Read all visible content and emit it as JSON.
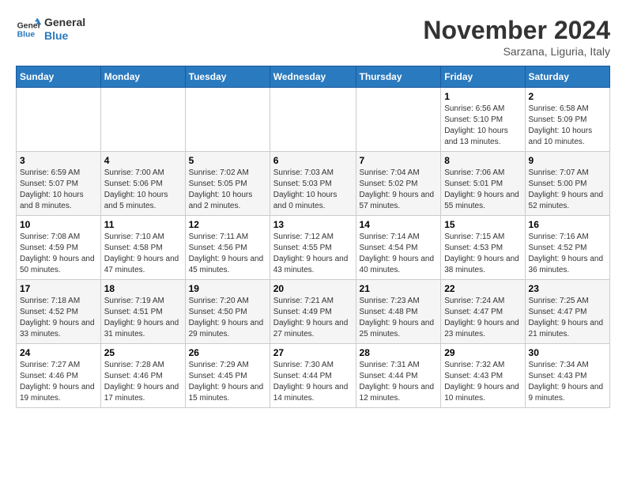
{
  "header": {
    "logo_line1": "General",
    "logo_line2": "Blue",
    "month_title": "November 2024",
    "subtitle": "Sarzana, Liguria, Italy"
  },
  "weekdays": [
    "Sunday",
    "Monday",
    "Tuesday",
    "Wednesday",
    "Thursday",
    "Friday",
    "Saturday"
  ],
  "weeks": [
    [
      {
        "day": "",
        "info": ""
      },
      {
        "day": "",
        "info": ""
      },
      {
        "day": "",
        "info": ""
      },
      {
        "day": "",
        "info": ""
      },
      {
        "day": "",
        "info": ""
      },
      {
        "day": "1",
        "info": "Sunrise: 6:56 AM\nSunset: 5:10 PM\nDaylight: 10 hours and 13 minutes."
      },
      {
        "day": "2",
        "info": "Sunrise: 6:58 AM\nSunset: 5:09 PM\nDaylight: 10 hours and 10 minutes."
      }
    ],
    [
      {
        "day": "3",
        "info": "Sunrise: 6:59 AM\nSunset: 5:07 PM\nDaylight: 10 hours and 8 minutes."
      },
      {
        "day": "4",
        "info": "Sunrise: 7:00 AM\nSunset: 5:06 PM\nDaylight: 10 hours and 5 minutes."
      },
      {
        "day": "5",
        "info": "Sunrise: 7:02 AM\nSunset: 5:05 PM\nDaylight: 10 hours and 2 minutes."
      },
      {
        "day": "6",
        "info": "Sunrise: 7:03 AM\nSunset: 5:03 PM\nDaylight: 10 hours and 0 minutes."
      },
      {
        "day": "7",
        "info": "Sunrise: 7:04 AM\nSunset: 5:02 PM\nDaylight: 9 hours and 57 minutes."
      },
      {
        "day": "8",
        "info": "Sunrise: 7:06 AM\nSunset: 5:01 PM\nDaylight: 9 hours and 55 minutes."
      },
      {
        "day": "9",
        "info": "Sunrise: 7:07 AM\nSunset: 5:00 PM\nDaylight: 9 hours and 52 minutes."
      }
    ],
    [
      {
        "day": "10",
        "info": "Sunrise: 7:08 AM\nSunset: 4:59 PM\nDaylight: 9 hours and 50 minutes."
      },
      {
        "day": "11",
        "info": "Sunrise: 7:10 AM\nSunset: 4:58 PM\nDaylight: 9 hours and 47 minutes."
      },
      {
        "day": "12",
        "info": "Sunrise: 7:11 AM\nSunset: 4:56 PM\nDaylight: 9 hours and 45 minutes."
      },
      {
        "day": "13",
        "info": "Sunrise: 7:12 AM\nSunset: 4:55 PM\nDaylight: 9 hours and 43 minutes."
      },
      {
        "day": "14",
        "info": "Sunrise: 7:14 AM\nSunset: 4:54 PM\nDaylight: 9 hours and 40 minutes."
      },
      {
        "day": "15",
        "info": "Sunrise: 7:15 AM\nSunset: 4:53 PM\nDaylight: 9 hours and 38 minutes."
      },
      {
        "day": "16",
        "info": "Sunrise: 7:16 AM\nSunset: 4:52 PM\nDaylight: 9 hours and 36 minutes."
      }
    ],
    [
      {
        "day": "17",
        "info": "Sunrise: 7:18 AM\nSunset: 4:52 PM\nDaylight: 9 hours and 33 minutes."
      },
      {
        "day": "18",
        "info": "Sunrise: 7:19 AM\nSunset: 4:51 PM\nDaylight: 9 hours and 31 minutes."
      },
      {
        "day": "19",
        "info": "Sunrise: 7:20 AM\nSunset: 4:50 PM\nDaylight: 9 hours and 29 minutes."
      },
      {
        "day": "20",
        "info": "Sunrise: 7:21 AM\nSunset: 4:49 PM\nDaylight: 9 hours and 27 minutes."
      },
      {
        "day": "21",
        "info": "Sunrise: 7:23 AM\nSunset: 4:48 PM\nDaylight: 9 hours and 25 minutes."
      },
      {
        "day": "22",
        "info": "Sunrise: 7:24 AM\nSunset: 4:47 PM\nDaylight: 9 hours and 23 minutes."
      },
      {
        "day": "23",
        "info": "Sunrise: 7:25 AM\nSunset: 4:47 PM\nDaylight: 9 hours and 21 minutes."
      }
    ],
    [
      {
        "day": "24",
        "info": "Sunrise: 7:27 AM\nSunset: 4:46 PM\nDaylight: 9 hours and 19 minutes."
      },
      {
        "day": "25",
        "info": "Sunrise: 7:28 AM\nSunset: 4:46 PM\nDaylight: 9 hours and 17 minutes."
      },
      {
        "day": "26",
        "info": "Sunrise: 7:29 AM\nSunset: 4:45 PM\nDaylight: 9 hours and 15 minutes."
      },
      {
        "day": "27",
        "info": "Sunrise: 7:30 AM\nSunset: 4:44 PM\nDaylight: 9 hours and 14 minutes."
      },
      {
        "day": "28",
        "info": "Sunrise: 7:31 AM\nSunset: 4:44 PM\nDaylight: 9 hours and 12 minutes."
      },
      {
        "day": "29",
        "info": "Sunrise: 7:32 AM\nSunset: 4:43 PM\nDaylight: 9 hours and 10 minutes."
      },
      {
        "day": "30",
        "info": "Sunrise: 7:34 AM\nSunset: 4:43 PM\nDaylight: 9 hours and 9 minutes."
      }
    ]
  ]
}
